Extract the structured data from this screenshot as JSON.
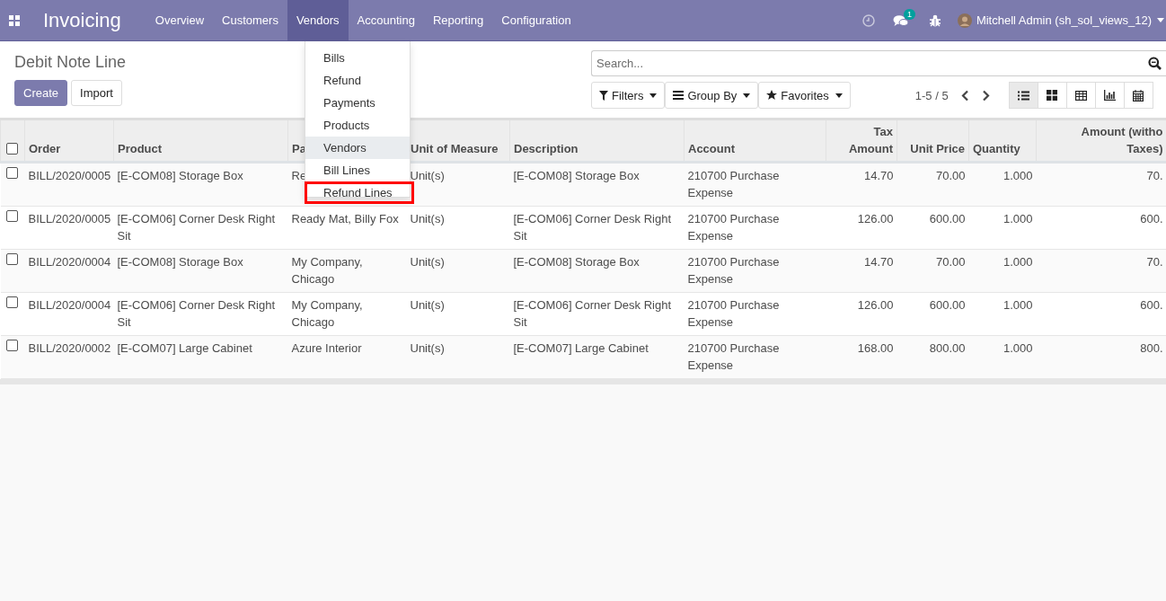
{
  "navbar": {
    "app_title": "Invoicing",
    "menu": [
      {
        "label": "Overview",
        "selected": false
      },
      {
        "label": "Customers",
        "selected": false
      },
      {
        "label": "Vendors",
        "selected": true
      },
      {
        "label": "Accounting",
        "selected": false
      },
      {
        "label": "Reporting",
        "selected": false
      },
      {
        "label": "Configuration",
        "selected": false
      }
    ],
    "message_count": "1",
    "user": "Mitchell Admin (sh_sol_views_12)"
  },
  "dropdown": [
    {
      "label": "Bills",
      "hovered": false,
      "annotated": false
    },
    {
      "label": "Refund",
      "hovered": false,
      "annotated": false
    },
    {
      "label": "Payments",
      "hovered": false,
      "annotated": false
    },
    {
      "label": "Products",
      "hovered": false,
      "annotated": false
    },
    {
      "label": "Vendors",
      "hovered": true,
      "annotated": false
    },
    {
      "label": "Bill Lines",
      "hovered": false,
      "annotated": false
    },
    {
      "label": "Refund Lines",
      "hovered": false,
      "annotated": true
    }
  ],
  "control_panel": {
    "breadcrumb": "Debit Note Line",
    "buttons": [
      "Create",
      "Import"
    ],
    "search": {
      "placeholder": "Search..."
    },
    "filters": [
      {
        "kind": "filter",
        "label": "Filters"
      },
      {
        "kind": "group",
        "label": "Group By"
      },
      {
        "kind": "favorite",
        "label": "Favorites"
      }
    ],
    "pager": "1-5 / 5",
    "views": [
      {
        "kind": "list",
        "selected": true
      },
      {
        "kind": "kanban",
        "selected": false
      },
      {
        "kind": "pivot",
        "selected": false
      },
      {
        "kind": "graph",
        "selected": false
      },
      {
        "kind": "calendar",
        "selected": false
      }
    ]
  },
  "table": {
    "select_all_checked": false,
    "columns": [
      "Order",
      "Product",
      "Pa",
      "Unit of Measure",
      "Description",
      "Account",
      "Tax Amount",
      "Unit Price",
      "Quantity",
      "Amount (witho Taxes)"
    ],
    "rows": [
      {
        "checked": false,
        "cells": [
          "BILL/2020/0005",
          "[E-COM08] Storage Box",
          "Re",
          "Unit(s)",
          "[E-COM08] Storage Box",
          "210700 Purchase Expense",
          "14.70",
          "70.00",
          "1.000",
          "70."
        ]
      },
      {
        "checked": false,
        "cells": [
          "BILL/2020/0005",
          "[E-COM06] Corner Desk Right Sit",
          "Ready Mat, Billy Fox",
          "Unit(s)",
          "[E-COM06] Corner Desk Right Sit",
          "210700 Purchase Expense",
          "126.00",
          "600.00",
          "1.000",
          "600."
        ]
      },
      {
        "checked": false,
        "cells": [
          "BILL/2020/0004",
          "[E-COM08] Storage Box",
          "My Company, Chicago",
          "Unit(s)",
          "[E-COM08] Storage Box",
          "210700 Purchase Expense",
          "14.70",
          "70.00",
          "1.000",
          "70."
        ]
      },
      {
        "checked": false,
        "cells": [
          "BILL/2020/0004",
          "[E-COM06] Corner Desk Right Sit",
          "My Company, Chicago",
          "Unit(s)",
          "[E-COM06] Corner Desk Right Sit",
          "210700 Purchase Expense",
          "126.00",
          "600.00",
          "1.000",
          "600."
        ]
      },
      {
        "checked": false,
        "cells": [
          "BILL/2020/0002",
          "[E-COM07] Large Cabinet",
          "Azure Interior",
          "Unit(s)",
          "[E-COM07] Large Cabinet",
          "210700 Purchase Expense",
          "168.00",
          "800.00",
          "1.000",
          "800."
        ]
      }
    ]
  }
}
